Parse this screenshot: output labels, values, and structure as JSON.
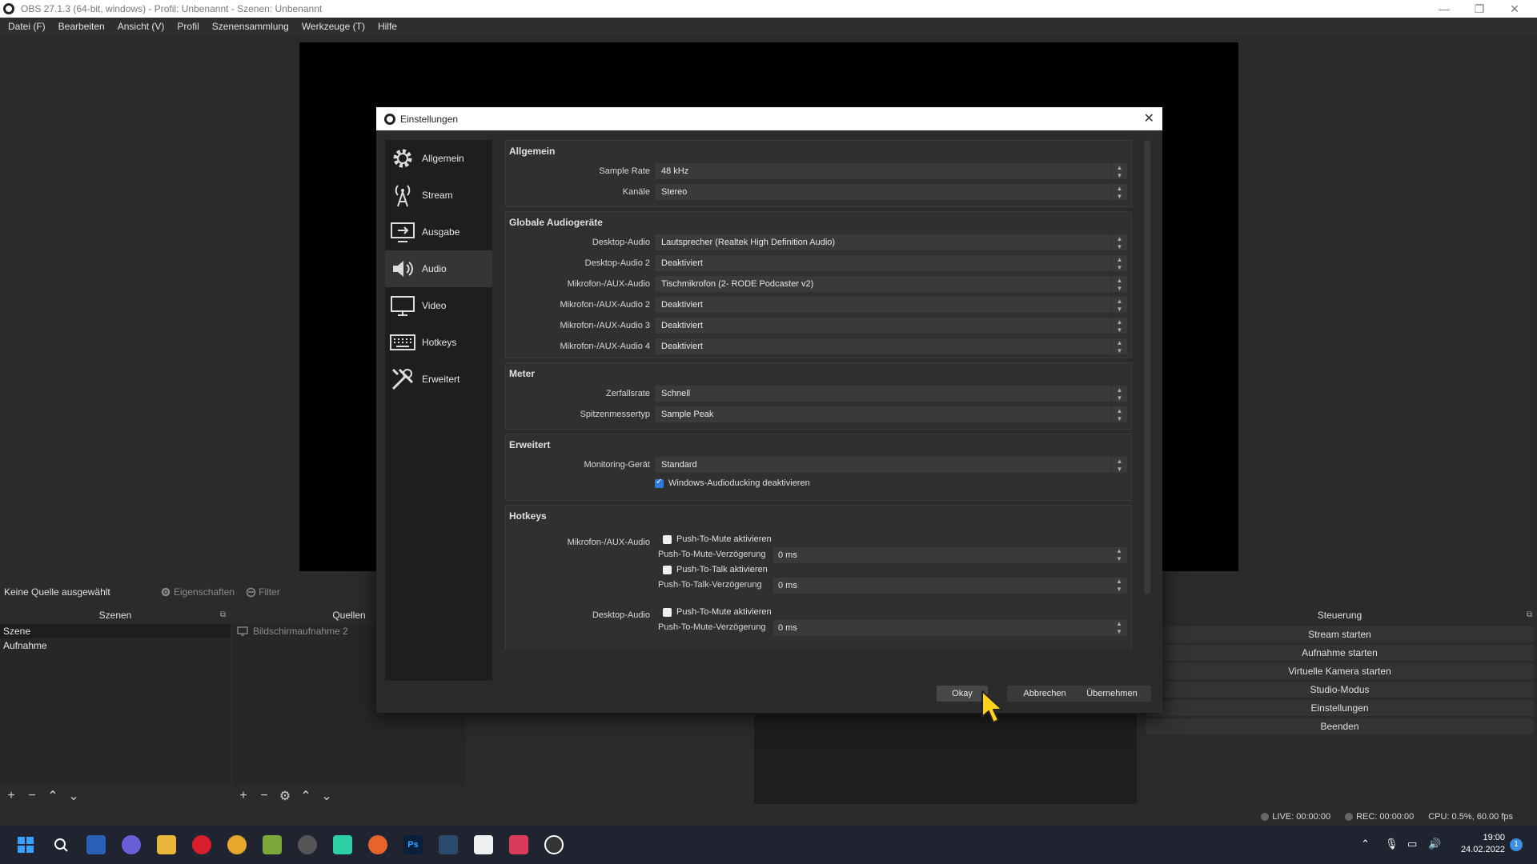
{
  "window": {
    "title": "OBS 27.1.3 (64-bit, windows) - Profil: Unbenannt - Szenen: Unbenannt",
    "minimize": "—",
    "maximize": "❐",
    "close": "✕"
  },
  "menu": [
    "Datei (F)",
    "Bearbeiten",
    "Ansicht (V)",
    "Profil",
    "Szenensammlung",
    "Werkzeuge (T)",
    "Hilfe"
  ],
  "source_toolbar": {
    "no_source": "Keine Quelle ausgewählt",
    "properties": "Eigenschaften",
    "filter": "Filter"
  },
  "scenes": {
    "header": "Szenen",
    "items": [
      "Szene",
      "Aufnahme"
    ]
  },
  "sources": {
    "header": "Quellen",
    "items": [
      "Bildschirmaufnahme 2"
    ]
  },
  "controls": {
    "header": "Steuerung",
    "buttons": [
      "Stream starten",
      "Aufnahme starten",
      "Virtuelle Kamera starten",
      "Studio-Modus",
      "Einstellungen",
      "Beenden"
    ]
  },
  "status": {
    "live": "LIVE: 00:00:00",
    "rec": "REC: 00:00:00",
    "cpu": "CPU: 0.5%, 60.00 fps"
  },
  "taskbar": {
    "time": "19:00",
    "date": "24.02.2022",
    "notification_count": "1",
    "ps_label": "Ps"
  },
  "dialog": {
    "title": "Einstellungen",
    "nav": [
      "Allgemein",
      "Stream",
      "Ausgabe",
      "Audio",
      "Video",
      "Hotkeys",
      "Erweitert"
    ],
    "active_nav": "Audio",
    "groups": {
      "allgemein": {
        "title": "Allgemein",
        "rows": [
          {
            "label": "Sample Rate",
            "value": "48 kHz"
          },
          {
            "label": "Kanäle",
            "value": "Stereo"
          }
        ]
      },
      "global_audio": {
        "title": "Globale Audiogeräte",
        "rows": [
          {
            "label": "Desktop-Audio",
            "value": "Lautsprecher (Realtek High Definition Audio)"
          },
          {
            "label": "Desktop-Audio 2",
            "value": "Deaktiviert"
          },
          {
            "label": "Mikrofon-/AUX-Audio",
            "value": "Tischmikrofon (2- RODE Podcaster v2)"
          },
          {
            "label": "Mikrofon-/AUX-Audio 2",
            "value": "Deaktiviert"
          },
          {
            "label": "Mikrofon-/AUX-Audio 3",
            "value": "Deaktiviert"
          },
          {
            "label": "Mikrofon-/AUX-Audio 4",
            "value": "Deaktiviert"
          }
        ]
      },
      "meter": {
        "title": "Meter",
        "rows": [
          {
            "label": "Zerfallsrate",
            "value": "Schnell"
          },
          {
            "label": "Spitzenmessertyp",
            "value": "Sample Peak"
          }
        ]
      },
      "erweitert": {
        "title": "Erweitert",
        "rows": [
          {
            "label": "Monitoring-Gerät",
            "value": "Standard"
          }
        ],
        "ducking_label": "Windows-Audioducking deaktivieren",
        "ducking_checked": true
      },
      "hotkeys": {
        "title": "Hotkeys",
        "mic_label": "Mikrofon-/AUX-Audio",
        "desktop_label": "Desktop-Audio",
        "ptm_enable": "Push-To-Mute aktivieren",
        "ptm_delay": "Push-To-Mute-Verzögerung",
        "ptt_enable": "Push-To-Talk aktivieren",
        "ptt_delay": "Push-To-Talk-Verzögerung",
        "delay_value": "0 ms"
      }
    },
    "buttons": {
      "ok": "Okay",
      "cancel": "Abbrechen",
      "apply": "Übernehmen"
    }
  }
}
